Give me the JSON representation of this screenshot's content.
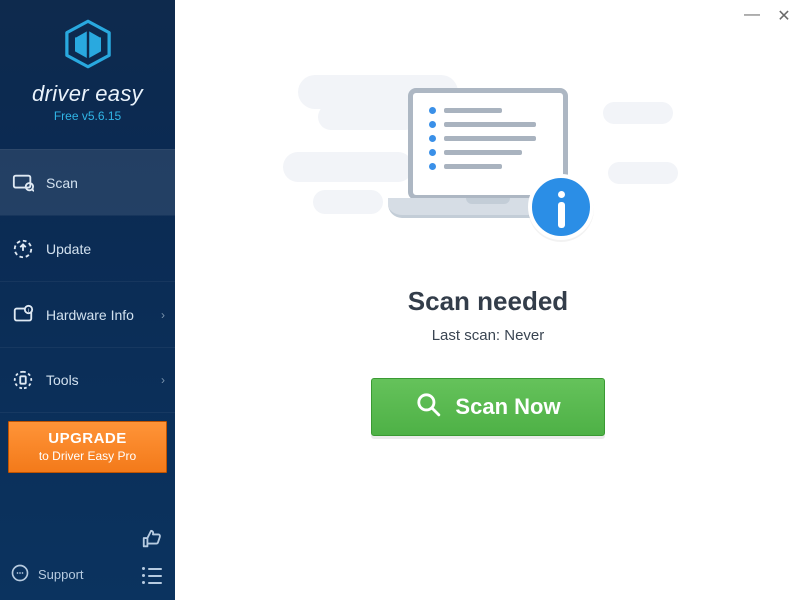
{
  "brand": {
    "app_name": "driver easy",
    "version_line": "Free v5.6.15",
    "logo_color": "#29a9df"
  },
  "sidebar": {
    "items": [
      {
        "label": "Scan",
        "icon": "scan-icon",
        "active": true,
        "has_submenu": false
      },
      {
        "label": "Update",
        "icon": "update-icon",
        "active": false,
        "has_submenu": false
      },
      {
        "label": "Hardware Info",
        "icon": "hardware-info-icon",
        "active": false,
        "has_submenu": true
      },
      {
        "label": "Tools",
        "icon": "tools-icon",
        "active": false,
        "has_submenu": true
      }
    ],
    "upgrade": {
      "line1": "UPGRADE",
      "line2": "to Driver Easy Pro"
    },
    "support_label": "Support"
  },
  "main": {
    "heading": "Scan needed",
    "last_scan_line": "Last scan: Never",
    "scan_button_label": "Scan Now"
  },
  "colors": {
    "primary_blue": "#2b8ee6",
    "scan_green": "#55b94c",
    "upgrade_orange": "#f6821f"
  }
}
